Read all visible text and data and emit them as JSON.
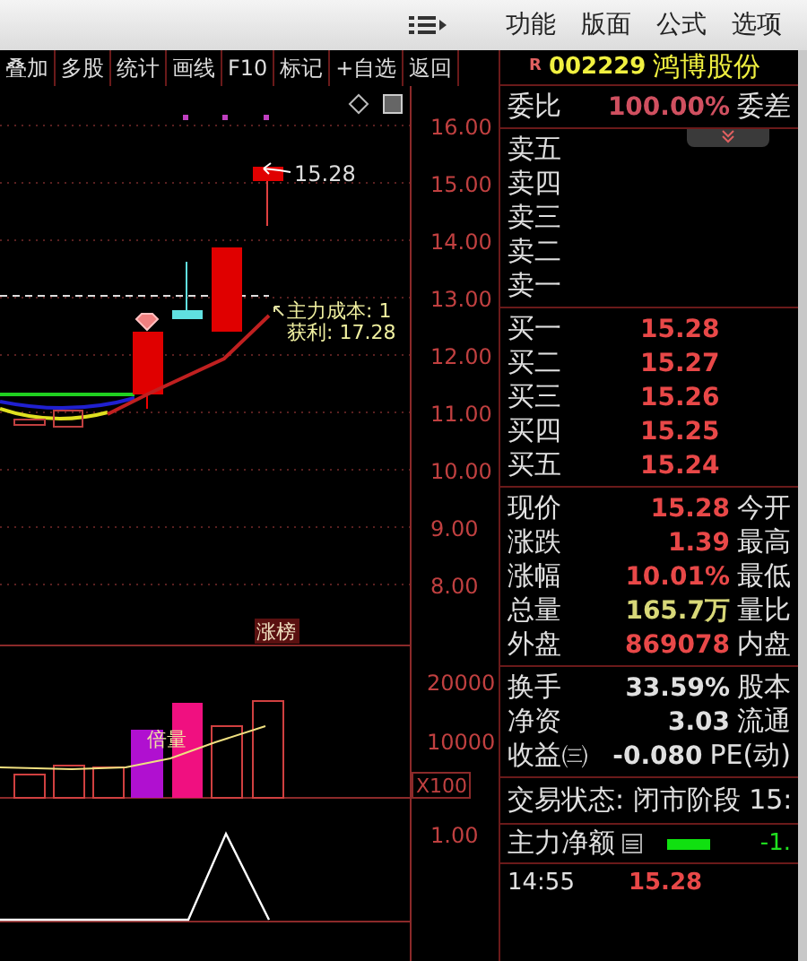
{
  "menu": {
    "items": [
      "功能",
      "版面",
      "公式",
      "选项"
    ]
  },
  "toolbar": {
    "buttons": [
      "叠加",
      "多股",
      "统计",
      "画线",
      "F10",
      "标记",
      "+自选",
      "返回"
    ]
  },
  "stock": {
    "badge": "R",
    "code": "002229",
    "name": "鸿博股份"
  },
  "commission": {
    "label": "委比",
    "value": "100.00%",
    "label_2": "委差"
  },
  "sell_orders": [
    {
      "label": "卖五"
    },
    {
      "label": "卖四"
    },
    {
      "label": "卖三"
    },
    {
      "label": "卖二"
    },
    {
      "label": "卖一"
    }
  ],
  "buy_orders": [
    {
      "label": "买一",
      "price": "15.28"
    },
    {
      "label": "买二",
      "price": "15.27"
    },
    {
      "label": "买三",
      "price": "15.26"
    },
    {
      "label": "买四",
      "price": "15.25"
    },
    {
      "label": "买五",
      "price": "15.24"
    }
  ],
  "quote_rows": [
    {
      "label": "现价",
      "value": "15.28",
      "label_2": "今开",
      "color": "#e84848"
    },
    {
      "label": "涨跌",
      "value": "1.39",
      "label_2": "最高",
      "color": "#e84848"
    },
    {
      "label": "涨幅",
      "value": "10.01%",
      "label_2": "最低",
      "color": "#e84848"
    },
    {
      "label": "总量",
      "value": "165.7万",
      "label_2": "量比",
      "color": "#d8d878"
    },
    {
      "label": "外盘",
      "value": "869078",
      "label_2": "内盘",
      "color": "#e84848"
    }
  ],
  "stats_rows": [
    {
      "label": "换手",
      "value": "33.59%",
      "label_2": "股本"
    },
    {
      "label": "净资",
      "value": "3.03",
      "label_2": "流通"
    },
    {
      "label": "收益㈢",
      "value": "-0.080",
      "label_2": "PE(动)"
    }
  ],
  "trading_status": "交易状态: 闭市阶段 15:",
  "main_net": {
    "label": "主力净额",
    "value": "-1."
  },
  "ticks": [
    {
      "time": "14:55",
      "price": "15.28"
    }
  ],
  "chart": {
    "price_axis": [
      "16.00",
      "15.00",
      "14.00",
      "13.00",
      "12.00",
      "11.00",
      "10.00",
      "9.00",
      "8.00"
    ],
    "price_label": "15.28",
    "cost_label": "主力成本: 1",
    "profit_label": "获利: 17.28",
    "limit_up_tag": "涨榜",
    "volume_axis": [
      "20000",
      "10000"
    ],
    "volume_unit": "X100",
    "volume_tag": "倍量",
    "indicator_axis": [
      "1.00"
    ]
  }
}
